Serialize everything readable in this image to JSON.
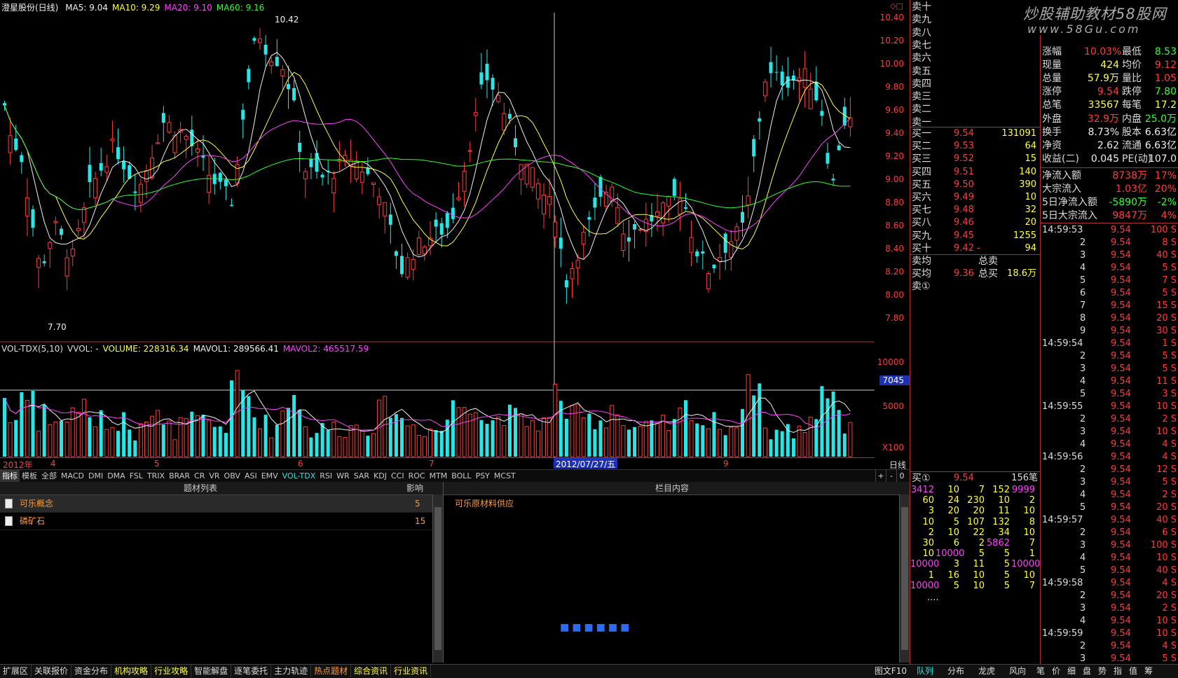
{
  "main_chart": {
    "title": "澄星股份(日线)",
    "ma_labels": [
      {
        "text": "MA5: 9.04",
        "color": "#f0f0f0"
      },
      {
        "text": "MA10: 9.29",
        "color": "#ffff3c"
      },
      {
        "text": "MA20: 9.10",
        "color": "#ff40ff"
      },
      {
        "text": "MA60: 9.16",
        "color": "#2cff2c"
      }
    ],
    "high_marker": "10.42",
    "low_marker": "7.70",
    "price_ticks": [
      "10.40",
      "10.20",
      "10.00",
      "9.80",
      "9.60",
      "9.40",
      "9.20",
      "9.00",
      "8.80",
      "8.60",
      "8.40",
      "8.20",
      "8.00",
      "7.80"
    ]
  },
  "volume_chart": {
    "labels": [
      {
        "text": "VOL-TDX(5,10)",
        "color": "#dddddd"
      },
      {
        "text": "VVOL: -",
        "color": "#dddddd"
      },
      {
        "text": "VOLUME: 228316.34",
        "color": "#ffff3c"
      },
      {
        "text": "MAVOL1: 289566.41",
        "color": "#f0f0f0"
      },
      {
        "text": "MAVOL2: 465517.59",
        "color": "#ff40ff"
      }
    ],
    "ticks": [
      "10000",
      "7045",
      "5000",
      "X100"
    ]
  },
  "date_axis": {
    "labels": [
      "2012年",
      "4",
      "5",
      "6",
      "7",
      "9"
    ],
    "cursor": "2012/07/27/五",
    "period": "日线"
  },
  "indicator_tabs": [
    "指标",
    "模板",
    "全部",
    "MACD",
    "DMI",
    "DMA",
    "FSL",
    "TRIX",
    "BRAR",
    "CR",
    "VR",
    "OBV",
    "ASI",
    "EMV",
    "VOL-TDX",
    "RSI",
    "WR",
    "SAR",
    "KDJ",
    "CCI",
    "ROC",
    "MTM",
    "BOLL",
    "PSY",
    "MCST"
  ],
  "indicator_active": "VOL-TDX",
  "zoom_buttons": [
    "+",
    "-",
    "0"
  ],
  "topic_panel": {
    "header": "题材列表",
    "impact_header": "影响",
    "rows": [
      {
        "name": "可乐概念",
        "impact": "5"
      },
      {
        "name": "磷矿石",
        "impact": "15"
      }
    ],
    "content_header": "栏目内容",
    "content_text": "可乐原材料供应",
    "loading": "■■■■■■"
  },
  "function_tabs": [
    "扩展区",
    "关联报价",
    "资金分布",
    "机构攻略",
    "行业攻略",
    "智能解盘",
    "逐笔委托",
    "主力轨迹",
    "热点题材",
    "综合资讯",
    "行业资讯"
  ],
  "function_right": "图文F10",
  "order_book": {
    "sell": [
      {
        "label": "卖十"
      },
      {
        "label": "卖九"
      },
      {
        "label": "卖八"
      },
      {
        "label": "卖七"
      },
      {
        "label": "卖六"
      },
      {
        "label": "卖五"
      },
      {
        "label": "卖四"
      },
      {
        "label": "卖三"
      },
      {
        "label": "卖二"
      },
      {
        "label": "卖一"
      }
    ],
    "buy": [
      {
        "label": "买一",
        "price": "9.54",
        "vol": "131091"
      },
      {
        "label": "买二",
        "price": "9.53",
        "vol": "64"
      },
      {
        "label": "买三",
        "price": "9.52",
        "vol": "15"
      },
      {
        "label": "买四",
        "price": "9.51",
        "vol": "140"
      },
      {
        "label": "买五",
        "price": "9.50",
        "vol": "390"
      },
      {
        "label": "买六",
        "price": "9.49",
        "vol": "10"
      },
      {
        "label": "买七",
        "price": "9.48",
        "vol": "32"
      },
      {
        "label": "买八",
        "price": "9.46",
        "vol": "20"
      },
      {
        "label": "买九",
        "price": "9.45",
        "vol": "1255"
      },
      {
        "label": "买十",
        "price": "9.42 -",
        "vol": "94"
      }
    ],
    "sell_avg_label": "卖均",
    "sell_total_label": "总卖",
    "buy_avg_label": "买均",
    "buy_avg": "9.36",
    "buy_total_label": "总买",
    "buy_total": "18.6万",
    "sell_queue_label": "卖①"
  },
  "watermark": {
    "line1": "炒股辅助教材58股网",
    "line2": "www.58Gu.com"
  },
  "stats": [
    {
      "k1": "涨幅",
      "v1": "10.03%",
      "c1": "#ff3b3b",
      "k2": "最低",
      "v2": "8.53",
      "c2": "#2cff2c"
    },
    {
      "k1": "现量",
      "v1": "424",
      "c1": "#ffff3c",
      "k2": "均价",
      "v2": "9.12",
      "c2": "#ff3b3b"
    },
    {
      "k1": "总量",
      "v1": "57.9万",
      "c1": "#ffff3c",
      "k2": "量比",
      "v2": "1.05",
      "c2": "#ff3b3b"
    },
    {
      "k1": "涨停",
      "v1": "9.54",
      "c1": "#ff3b3b",
      "k2": "跌停",
      "v2": "7.80",
      "c2": "#2cff2c"
    },
    {
      "k1": "总笔",
      "v1": "33567",
      "c1": "#ffff3c",
      "k2": "每笔",
      "v2": "17.2",
      "c2": "#ffff3c"
    },
    {
      "k1": "外盘",
      "v1": "32.9万",
      "c1": "#ff3b3b",
      "k2": "内盘",
      "v2": "25.0万",
      "c2": "#2cff2c"
    },
    {
      "k1": "换手",
      "v1": "8.73%",
      "c1": "#f0f0f0",
      "k2": "股本",
      "v2": "6.63亿",
      "c2": "#f0f0f0"
    },
    {
      "k1": "净资",
      "v1": "2.62",
      "c1": "#f0f0f0",
      "k2": "流通",
      "v2": "6.63亿",
      "c2": "#f0f0f0"
    },
    {
      "k1": "收益(二)",
      "v1": "0.045",
      "c1": "#f0f0f0",
      "k2": "PE(动)",
      "v2": "107.0",
      "c2": "#f0f0f0"
    }
  ],
  "flows": [
    {
      "label": "净流入额",
      "value": "8738万",
      "pct": "17%",
      "color": "#ff3b3b"
    },
    {
      "label": "大宗流入",
      "value": "1.03亿",
      "pct": "20%",
      "color": "#ff3b3b"
    },
    {
      "label": "5日净流入额",
      "value": "-5890万",
      "pct": "-2%",
      "color": "#2cff2c"
    },
    {
      "label": "5日大宗流入",
      "value": "9847万",
      "pct": "4%",
      "color": "#ff3b3b"
    }
  ],
  "ticks": [
    {
      "t": "14:59:53",
      "p": "9.54",
      "v": "100 S"
    },
    {
      "t": "2",
      "p": "9.54",
      "v": "8 S"
    },
    {
      "t": "3",
      "p": "9.54",
      "v": "40 S"
    },
    {
      "t": "4",
      "p": "9.54",
      "v": "5 S"
    },
    {
      "t": "5",
      "p": "9.54",
      "v": "7 S"
    },
    {
      "t": "6",
      "p": "9.54",
      "v": "5 S"
    },
    {
      "t": "7",
      "p": "9.54",
      "v": "15 S"
    },
    {
      "t": "8",
      "p": "9.54",
      "v": "20 S"
    },
    {
      "t": "9",
      "p": "9.54",
      "v": "30 S"
    },
    {
      "t": "14:59:54",
      "p": "9.54",
      "v": "1 S"
    },
    {
      "t": "2",
      "p": "9.54",
      "v": "5 S"
    },
    {
      "t": "3",
      "p": "9.54",
      "v": "5 S"
    },
    {
      "t": "4",
      "p": "9.54",
      "v": "11 S"
    },
    {
      "t": "5",
      "p": "9.54",
      "v": "3 S"
    },
    {
      "t": "14:59:55",
      "p": "9.54",
      "v": "10 S"
    },
    {
      "t": "2",
      "p": "9.54",
      "v": "2 S"
    },
    {
      "t": "3",
      "p": "9.54",
      "v": "10 S"
    },
    {
      "t": "4",
      "p": "9.54",
      "v": "4 S"
    },
    {
      "t": "14:59:56",
      "p": "9.54",
      "v": "4 S"
    },
    {
      "t": "2",
      "p": "9.54",
      "v": "12 S"
    },
    {
      "t": "3",
      "p": "9.54",
      "v": "5 S"
    },
    {
      "t": "4",
      "p": "9.54",
      "v": "2 S"
    },
    {
      "t": "5",
      "p": "9.54",
      "v": "20 S"
    },
    {
      "t": "14:59:57",
      "p": "9.54",
      "v": "40 S"
    },
    {
      "t": "2",
      "p": "9.54",
      "v": "6 S"
    },
    {
      "t": "3",
      "p": "9.54",
      "v": "100 S"
    },
    {
      "t": "4",
      "p": "9.54",
      "v": "10 S"
    },
    {
      "t": "5",
      "p": "9.54",
      "v": "40 S"
    },
    {
      "t": "14:59:58",
      "p": "9.54",
      "v": "4 S"
    },
    {
      "t": "2",
      "p": "9.54",
      "v": "20 S"
    },
    {
      "t": "3",
      "p": "9.54",
      "v": "2 S"
    },
    {
      "t": "4",
      "p": "9.54",
      "v": "10 S"
    },
    {
      "t": "14:59:59",
      "p": "9.54",
      "v": "10 S"
    },
    {
      "t": "2",
      "p": "9.54",
      "v": "4 S"
    },
    {
      "t": "3",
      "p": "9.54",
      "v": "5 S"
    },
    {
      "t": "4",
      "p": "9.54",
      "v": "24 S"
    }
  ],
  "queue": {
    "label": "买①",
    "price": "9.54",
    "count": "156笔",
    "rows": [
      [
        "3412",
        "10",
        "7",
        "152",
        "9999"
      ],
      [
        "60",
        "24",
        "230",
        "10",
        "2"
      ],
      [
        "3",
        "20",
        "20",
        "11",
        "10"
      ],
      [
        "10",
        "5",
        "107",
        "132",
        "8"
      ],
      [
        "2",
        "10",
        "22",
        "34",
        "10"
      ],
      [
        "30",
        "6",
        "2",
        "5862",
        "7"
      ],
      [
        "10",
        "10000",
        "5",
        "5",
        "1"
      ],
      [
        "10000",
        "3",
        "11",
        "5",
        "10000"
      ],
      [
        "1",
        "16",
        "10",
        "5",
        "10"
      ],
      [
        "10000",
        "5",
        "10",
        "5",
        "7"
      ]
    ],
    "more": "...."
  },
  "right_tabs": [
    "队列",
    "分布",
    "龙虎",
    "风向",
    "笔",
    "价",
    "细",
    "盘",
    "势",
    "指",
    "值",
    "筹"
  ],
  "right_tab_active": "队列",
  "colors": {
    "up": "#ff3b3b",
    "down": "#29e6e6",
    "ma5": "#f0f0f0",
    "ma10": "#ffff3c",
    "ma20": "#ff40ff",
    "ma60": "#2cff2c"
  }
}
